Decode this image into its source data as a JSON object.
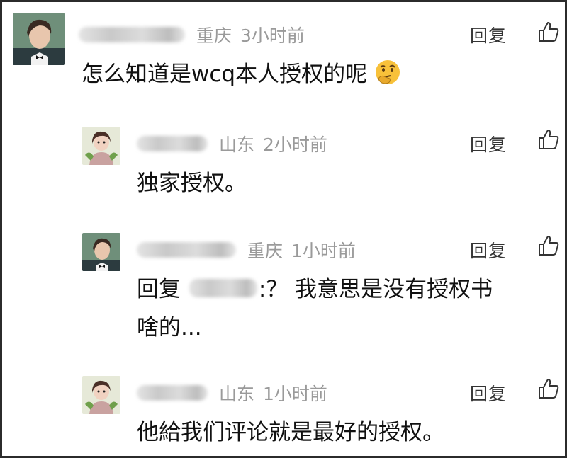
{
  "comments": [
    {
      "location": "重庆",
      "time": "3小时前",
      "reply_label": "回复",
      "text": "怎么知道是wcq本人授权的呢",
      "emoji": "thinking-face-emoji"
    },
    {
      "location": "山东",
      "time": "2小时前",
      "reply_label": "回复",
      "text": "独家授权。"
    },
    {
      "location": "重庆",
      "time": "1小时前",
      "reply_label": "回复",
      "text_prefix": "回复",
      "text_after_mention": ":？ 我意思是没有授权书",
      "text_line2": "啥的..."
    },
    {
      "location": "山东",
      "time": "1小时前",
      "reply_label": "回复",
      "text": "他給我们评论就是最好的授权。"
    }
  ],
  "icons": {
    "like": "thumbs-up-icon"
  },
  "colors": {
    "meta": "#9a9a9a",
    "text": "#111111",
    "border": "#2b2b2b"
  }
}
